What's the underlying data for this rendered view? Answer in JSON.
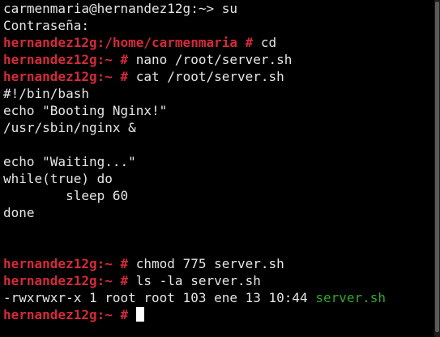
{
  "colors": {
    "background": "#000000",
    "text": "#e5e5e5",
    "prompt": "#d42a3a",
    "executable": "#2fa82f",
    "cursor": "#ffffff"
  },
  "terminal": {
    "lines": [
      {
        "text": "carmenmaria@hernandez12g:~> su"
      },
      {
        "text": "Contraseña:"
      },
      {
        "prompt": "hernandez12g:/home/carmenmaria # ",
        "text": "cd"
      },
      {
        "prompt": "hernandez12g:~ # ",
        "text": "nano /root/server.sh"
      },
      {
        "prompt": "hernandez12g:~ # ",
        "text": "cat /root/server.sh"
      },
      {
        "text": "#!/bin/bash"
      },
      {
        "text": "echo \"Booting Nginx!\""
      },
      {
        "text": "/usr/sbin/nginx &"
      },
      {
        "text": ""
      },
      {
        "text": "echo \"Waiting...\""
      },
      {
        "text": "while(true) do"
      },
      {
        "text": "        sleep 60"
      },
      {
        "text": "done"
      },
      {
        "text": ""
      },
      {
        "text": ""
      },
      {
        "prompt": "hernandez12g:~ # ",
        "text": "chmod 775 server.sh"
      },
      {
        "prompt": "hernandez12g:~ # ",
        "text": "ls -la server.sh"
      },
      {
        "text": "-rwxrwxr-x 1 root root 103 ene 13 10:44 ",
        "exec": "server.sh"
      },
      {
        "prompt": "hernandez12g:~ # ",
        "text": ""
      }
    ]
  }
}
